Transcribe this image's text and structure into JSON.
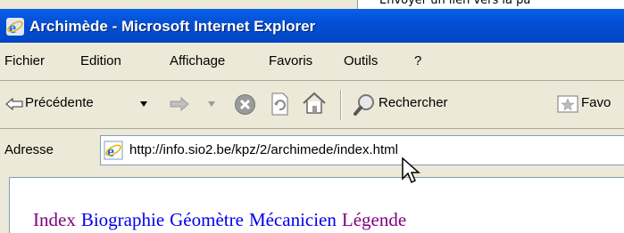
{
  "background_text": "Envoyer un lien vers la pa",
  "window": {
    "title": "Archimède - Microsoft Internet Explorer"
  },
  "menu": [
    "Fichier",
    "Edition",
    "Affichage",
    "Favoris",
    "Outils",
    "?"
  ],
  "toolbar": {
    "back_label": "Précédente",
    "search_label": "Rechercher",
    "favorites_label": "Favo"
  },
  "address": {
    "label": "Adresse",
    "url": "http://info.sio2.be/kpz/2/archimede/index.html"
  },
  "page_links": [
    {
      "label": "Index",
      "color": "#800080"
    },
    {
      "label": "Biographie",
      "color": "#0000ee"
    },
    {
      "label": "Géomètre",
      "color": "#0000ee"
    },
    {
      "label": "Mécanicien",
      "color": "#0000ee"
    },
    {
      "label": "Légende",
      "color": "#800080"
    }
  ]
}
